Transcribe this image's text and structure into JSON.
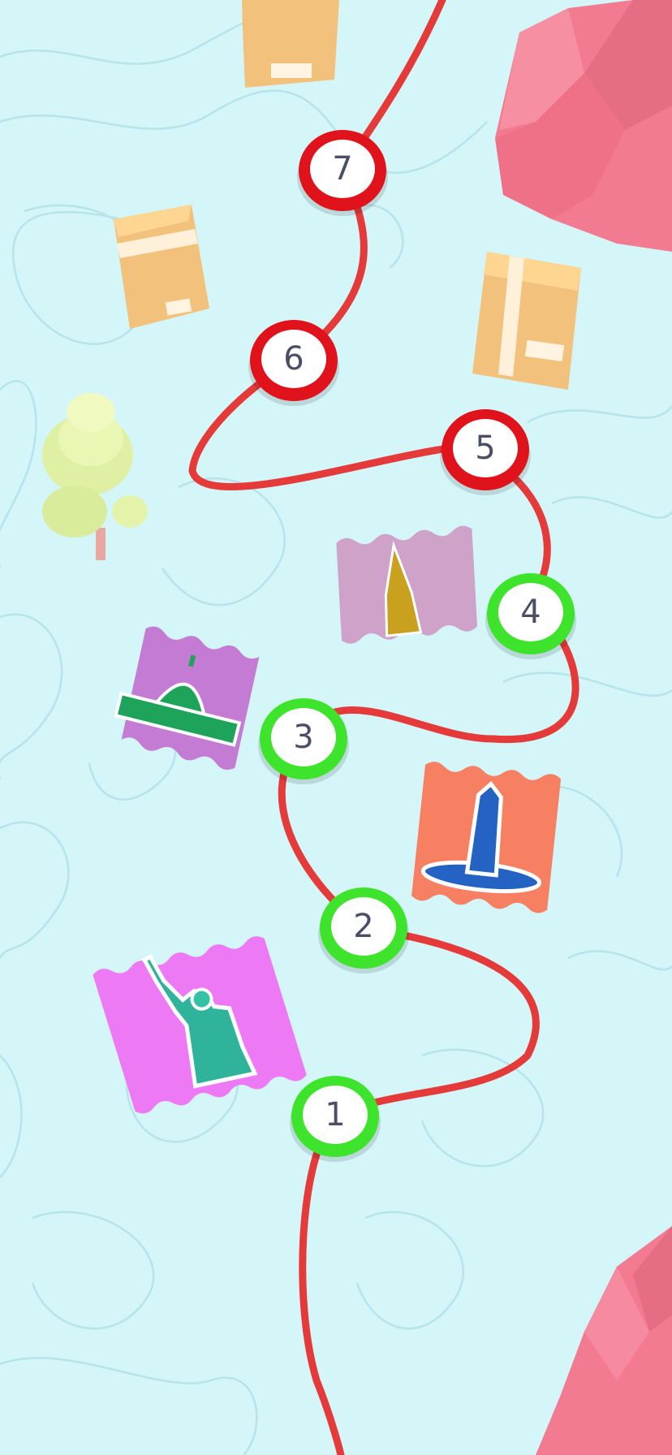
{
  "levels": [
    {
      "number": "1",
      "state": "completed"
    },
    {
      "number": "2",
      "state": "completed"
    },
    {
      "number": "3",
      "state": "completed"
    },
    {
      "number": "4",
      "state": "completed"
    },
    {
      "number": "5",
      "state": "locked"
    },
    {
      "number": "6",
      "state": "locked"
    },
    {
      "number": "7",
      "state": "locked"
    }
  ],
  "stamps": [
    {
      "landmark": "statue-of-liberty",
      "color": "#ee79f5"
    },
    {
      "landmark": "washington-monument",
      "color": "#f77f62"
    },
    {
      "landmark": "us-capitol",
      "color": "#c37bd4"
    },
    {
      "landmark": "empire-state-building",
      "color": "#cfa2c9"
    }
  ],
  "decorations": [
    "cardboard-box",
    "cardboard-box",
    "cardboard-box",
    "pink-rock",
    "pink-rock",
    "bush-tree"
  ],
  "colors": {
    "background": "#d4f6f8",
    "topo_lines": "#b7e3ea",
    "path": "#e53a3a",
    "completed_ring": "#3ee32b",
    "locked_ring": "#e0121b",
    "node_face": "#ffffff",
    "node_text": "#4b4f66"
  }
}
